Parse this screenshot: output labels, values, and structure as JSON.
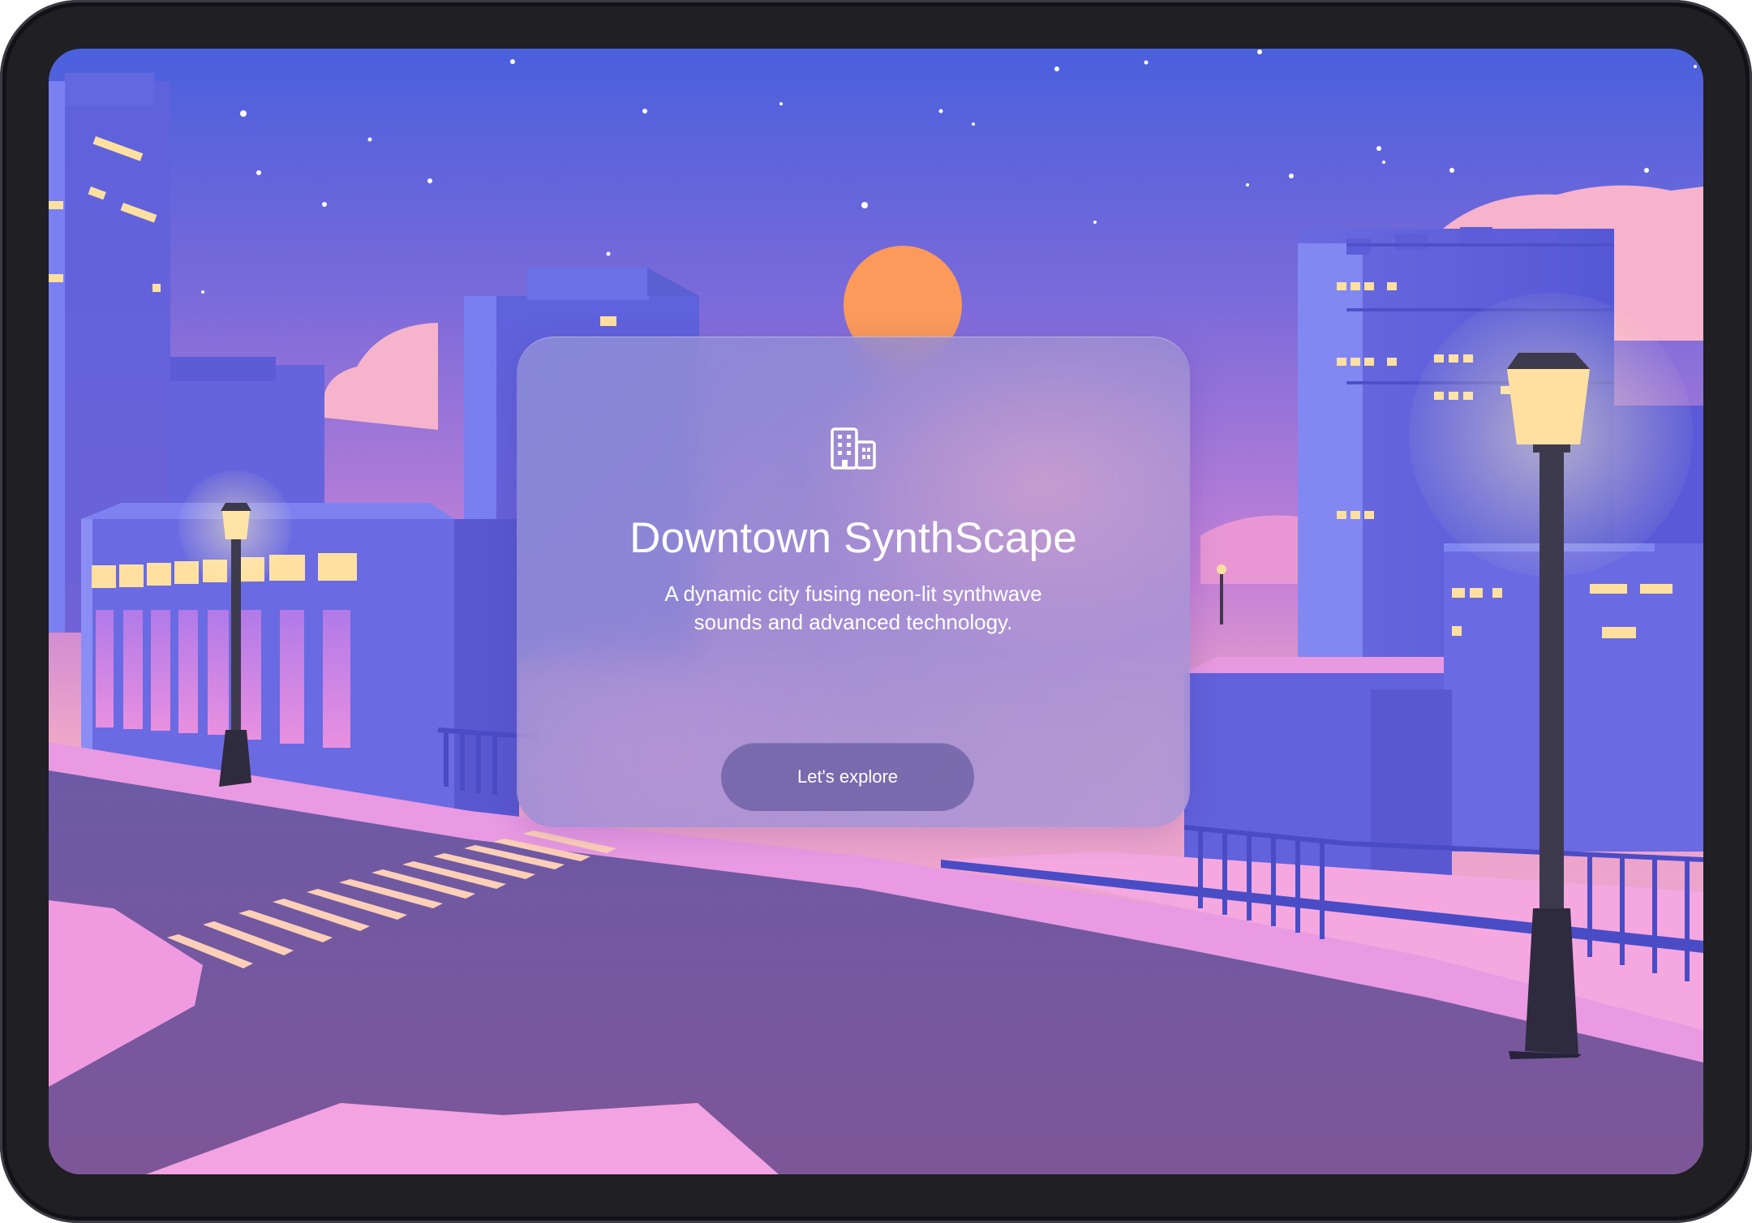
{
  "hero": {
    "icon": "building-icon",
    "title": "Downtown SynthScape",
    "description": "A dynamic city fusing neon-lit synthwave sounds and advanced technology.",
    "cta_label": "Let's explore"
  },
  "colors": {
    "sky_top": "#4a60dd",
    "sky_bottom": "#f0a8c8",
    "sun": "#fb9a5a",
    "building": "#6d68dc",
    "window_lit": "#ffe0a0",
    "street": "#7a5a9c",
    "sidewalk": "#f09ae0",
    "lamp": "#3e3a4e"
  }
}
